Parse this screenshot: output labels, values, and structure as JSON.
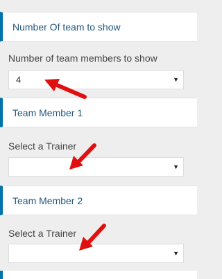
{
  "sections": [
    {
      "header": "Number Of team to show",
      "field_label": "Number of team members to show",
      "select_value": "4"
    },
    {
      "header": "Team Member 1",
      "field_label": "Select a Trainer",
      "select_value": ""
    },
    {
      "header": "Team Member 2",
      "field_label": "Select a Trainer",
      "select_value": ""
    }
  ],
  "chevron_glyph": "▼",
  "icons": {
    "chevron": "chevron-down-icon",
    "annotation": "red-arrow-icon"
  },
  "colors": {
    "accent": "#0073aa",
    "header_text": "#23577f",
    "annotation": "#e01010"
  }
}
